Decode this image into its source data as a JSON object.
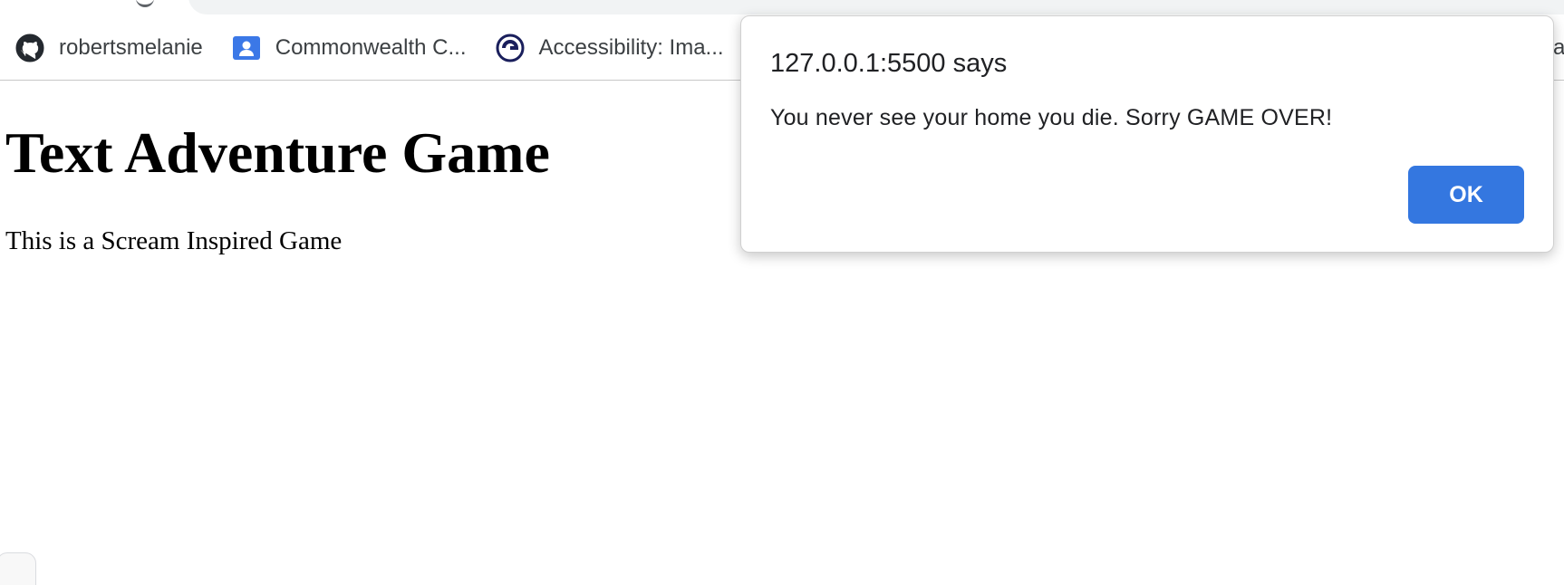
{
  "bookmarks": [
    {
      "label": "robertsmelanie",
      "icon": "github-icon"
    },
    {
      "label": "Commonwealth C...",
      "icon": "contact-card-icon"
    },
    {
      "label": "Accessibility: Ima...",
      "icon": "accessibility-site-icon"
    }
  ],
  "bookmarks_overflow_glyph": "ar",
  "page": {
    "title": "Text Adventure Game",
    "subtitle": "This is a Scream Inspired Game"
  },
  "dialog": {
    "title": "127.0.0.1:5500 says",
    "message": "You never see your home you die. Sorry GAME OVER!",
    "ok_label": "OK"
  },
  "colors": {
    "ok_button": "#3477e0",
    "contact_icon": "#3b78e7",
    "accessibility_icon": "#1a1f5c"
  }
}
